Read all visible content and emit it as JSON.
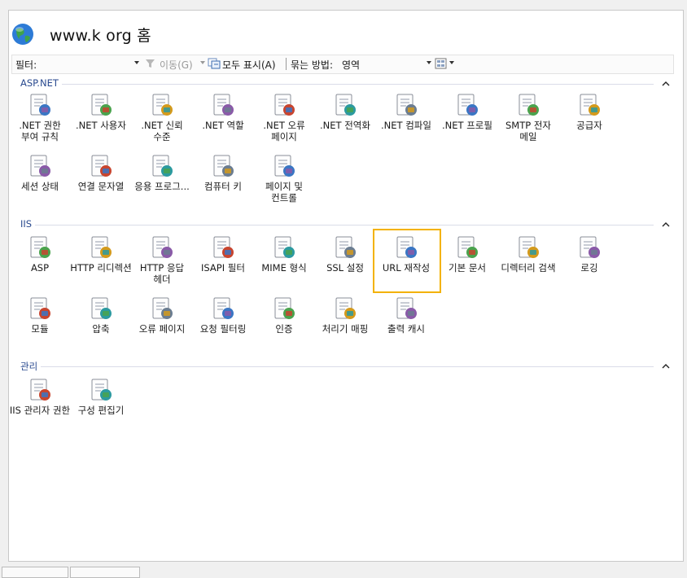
{
  "header": {
    "host_title": "www.k     org 홈"
  },
  "toolbar": {
    "filter_label": "필터:",
    "filter_value": "",
    "go_label": "이동(G)",
    "show_all_label": "모두 표시(A)",
    "group_by_label": "묶는 방법:",
    "group_by_value": "영역"
  },
  "sections": {
    "aspnet": {
      "title": "ASP.NET",
      "items": [
        {
          "label": ".NET 권한 부여 규칙",
          "icon": "lock-doc-icon"
        },
        {
          "label": ".NET 사용자",
          "icon": "users-globe-icon"
        },
        {
          "label": ".NET 신뢰 수준",
          "icon": "trust-check-icon"
        },
        {
          "label": ".NET 역할",
          "icon": "role-cards-icon"
        },
        {
          "label": ".NET 오류 페이지",
          "icon": "error-404-icon"
        },
        {
          "label": ".NET 전역화",
          "icon": "globe-stand-icon"
        },
        {
          "label": ".NET 컴파일",
          "icon": "compile-stack-icon"
        },
        {
          "label": ".NET 프로필",
          "icon": "profile-pages-icon"
        },
        {
          "label": "SMTP 전자 메일",
          "icon": "smtp-mail-icon"
        },
        {
          "label": "공급자",
          "icon": "provider-db-icon"
        },
        {
          "label": "세션 상태",
          "icon": "session-user-icon"
        },
        {
          "label": "연결 문자열",
          "icon": "connection-string-icon"
        },
        {
          "label": "응용 프로그...",
          "icon": "app-settings-icon"
        },
        {
          "label": "컴퓨터 키",
          "icon": "machine-key-icon"
        },
        {
          "label": "페이지 및 컨트롤",
          "icon": "pages-controls-icon"
        }
      ]
    },
    "iis": {
      "title": "IIS",
      "items": [
        {
          "label": "ASP",
          "icon": "asp-gear-icon"
        },
        {
          "label": "HTTP 리디렉션",
          "icon": "http-redirect-icon"
        },
        {
          "label": "HTTP 응답 헤더",
          "icon": "response-headers-icon"
        },
        {
          "label": "ISAPI 필터",
          "icon": "isapi-filter-icon"
        },
        {
          "label": "MIME 형식",
          "icon": "mime-types-icon"
        },
        {
          "label": "SSL 설정",
          "icon": "ssl-lock-icon"
        },
        {
          "label": "URL 재작성",
          "icon": "url-rewrite-icon"
        },
        {
          "label": "기본 문서",
          "icon": "default-document-icon"
        },
        {
          "label": "디렉터리 검색",
          "icon": "directory-browse-icon"
        },
        {
          "label": "로깅",
          "icon": "logging-book-icon"
        },
        {
          "label": "모듈",
          "icon": "modules-icon"
        },
        {
          "label": "압축",
          "icon": "compression-vise-icon"
        },
        {
          "label": "오류 페이지",
          "icon": "error-pages-icon"
        },
        {
          "label": "요청 필터링",
          "icon": "request-filter-icon"
        },
        {
          "label": "인증",
          "icon": "authentication-icon"
        },
        {
          "label": "처리기 매핑",
          "icon": "handler-mappings-icon"
        },
        {
          "label": "출력 캐시",
          "icon": "output-cache-icon"
        }
      ]
    },
    "management": {
      "title": "관리",
      "items": [
        {
          "label": "IIS 관리자 권한",
          "icon": "manager-permissions-icon"
        },
        {
          "label": "구성 편집기",
          "icon": "config-editor-icon"
        }
      ]
    }
  },
  "selected_item": "URL 재작성",
  "colors": {
    "accent_section": "#2a4a8f",
    "selection": "#f3b200"
  }
}
